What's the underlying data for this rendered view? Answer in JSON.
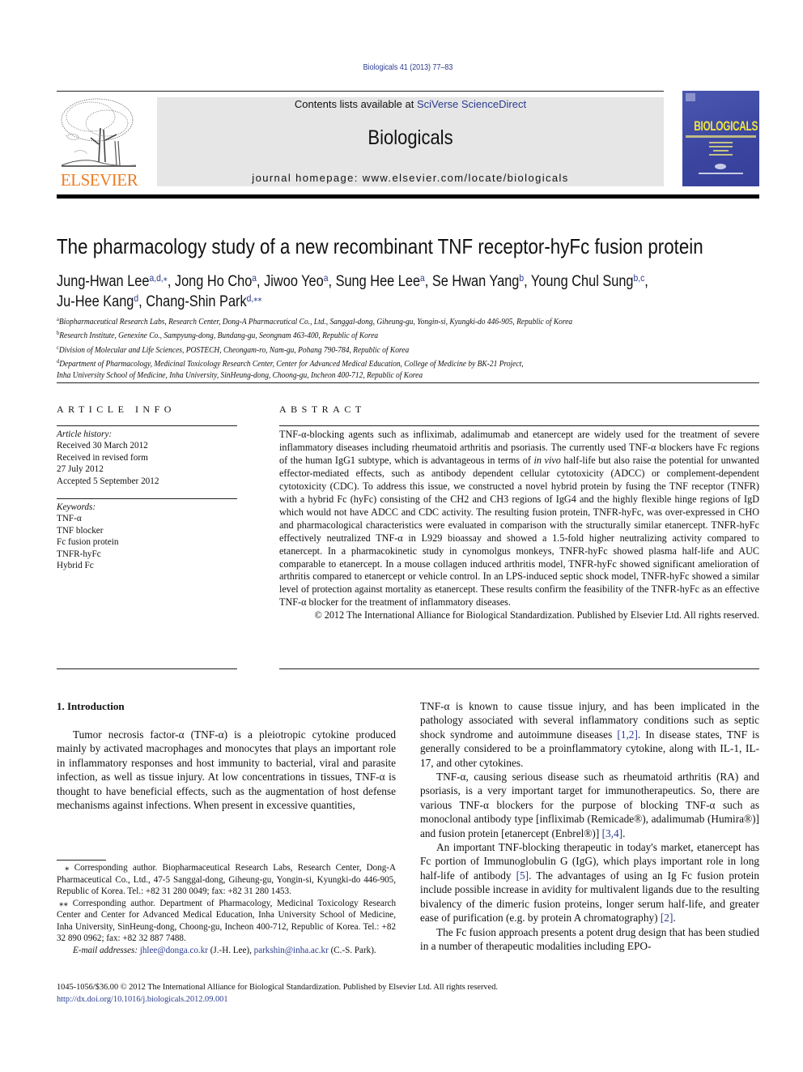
{
  "header": {
    "journal_ref": "Biologicals 41 (2013) 77–83",
    "contents_prefix": "Contents lists available at ",
    "contents_link": "SciVerse ScienceDirect",
    "journal_name": "Biologicals",
    "homepage": "journal homepage: www.elsevier.com/locate/biologicals",
    "publisher_logo_text": "ELSEVIER",
    "cover_title": "BIOLOGICALS"
  },
  "article": {
    "title": "The pharmacology study of a new recombinant TNF receptor-hyFc fusion protein",
    "authors": [
      {
        "name": "Jung-Hwan Lee",
        "sup": "a,d,⁎",
        "sep": ", "
      },
      {
        "name": "Jong Ho Cho",
        "sup": "a",
        "sep": ", "
      },
      {
        "name": "Jiwoo Yeo",
        "sup": "a",
        "sep": ", "
      },
      {
        "name": "Sung Hee Lee",
        "sup": "a",
        "sep": ", "
      },
      {
        "name": "Se Hwan Yang",
        "sup": "b",
        "sep": ", "
      },
      {
        "name": "Young Chul Sung",
        "sup": "b,c",
        "sep": ","
      },
      {
        "name": "Ju-Hee Kang",
        "sup": "d",
        "sep": ", "
      },
      {
        "name": "Chang-Shin Park",
        "sup": "d,⁎⁎",
        "sep": ""
      }
    ],
    "affiliations": [
      {
        "key": "a",
        "text": "Biopharmaceutical Research Labs, Research Center, Dong-A Pharmaceutical Co., Ltd., Sanggal-dong, Giheung-gu, Yongin-si, Kyungki-do 446-905, Republic of Korea"
      },
      {
        "key": "b",
        "text": "Research Institute, Genexine Co., Sampyung-dong, Bundang-gu, Seongnam 463-400, Republic of Korea"
      },
      {
        "key": "c",
        "text": "Division of Molecular and Life Sciences, POSTECH, Cheongam-ro, Nam-gu, Pohang 790-784, Republic of Korea"
      },
      {
        "key": "d",
        "text": "Department of Pharmacology, Medicinal Toxicology Research Center, Center for Advanced Medical Education, College of Medicine by BK-21 Project,"
      },
      {
        "key": "",
        "text": "Inha University School of Medicine, Inha University, SinHeung-dong, Choong-gu, Incheon 400-712, Republic of Korea"
      }
    ]
  },
  "article_info": {
    "heading": "ARTICLE INFO",
    "history_label": "Article history:",
    "history": [
      "Received 30 March 2012",
      "Received in revised form",
      "27 July 2012",
      "Accepted 5 September 2012"
    ],
    "keywords_label": "Keywords:",
    "keywords": [
      "TNF-α",
      "TNF blocker",
      "Fc fusion protein",
      "TNFR-hyFc",
      "Hybrid Fc"
    ]
  },
  "abstract": {
    "heading": "ABSTRACT",
    "body_1": "TNF-α-blocking agents such as infliximab, adalimumab and etanercept are widely used for the treatment of severe inflammatory diseases including rheumatoid arthritis and psoriasis. The currently used TNF-α blockers have Fc regions of the human IgG1 subtype, which is advantageous in terms of ",
    "body_italic": "in vivo",
    "body_2": " half-life but also raise the potential for unwanted effector-mediated effects, such as antibody dependent cellular cytotoxicity (ADCC) or complement-dependent cytotoxicity (CDC). To address this issue, we constructed a novel hybrid protein by fusing the TNF receptor (TNFR) with a hybrid Fc (hyFc) consisting of the CH2 and CH3 regions of IgG4 and the highly flexible hinge regions of IgD which would not have ADCC and CDC activity. The resulting fusion protein, TNFR-hyFc, was over-expressed in CHO and pharmacological characteristics were evaluated in comparison with the structurally similar etanercept. TNFR-hyFc effectively neutralized TNF-α in L929 bioassay and showed a 1.5-fold higher neutralizing activity compared to etanercept. In a pharmacokinetic study in cynomolgus monkeys, TNFR-hyFc showed plasma half-life and AUC comparable to etanercept. In a mouse collagen induced arthritis model, TNFR-hyFc showed significant amelioration of arthritis compared to etanercept or vehicle control. In an LPS-induced septic shock model, TNFR-hyFc showed a similar level of protection against mortality as eta­nercept. These results confirm the feasibility of the TNFR-hyFc as an effective TNF-α blocker for the treatment of inflammatory diseases.",
    "copyright": "© 2012 The International Alliance for Biological Standardization. Published by Elsevier Ltd. All rights reserved."
  },
  "introduction": {
    "heading": "1.  Introduction",
    "left_para": "Tumor necrosis factor-α (TNF-α) is a pleiotropic cytokine produced mainly by activated macrophages and monocytes that plays an important role in inflammatory responses and host immunity to bacterial, viral and parasite infection, as well as tissue injury. At low concentrations in tissues, TNF-α is thought to have beneficial effects, such as the augmentation of host defense mech­anisms against infections. When present in excessive quantities,",
    "right_p1_a": "TNF-α is known to cause tissue injury, and has been implicated in the pathology associated with several inflammatory conditions such as septic shock syndrome and autoimmune diseases ",
    "right_p1_ref": "[1,2]",
    "right_p1_b": ". In disease states, TNF is generally considered to be a proinflammatory cytokine, along with IL-1, IL-17, and other cytokines.",
    "right_p2_a": "TNF-α, causing serious disease such as rheumatoid arthritis (RA) and psoriasis, is a very important target for immunotherapeutics. So, there are various TNF-α blockers for the purpose of blocking TNF-α such as monoclonal antibody type [infliximab (Remicade®), ada­limumab (Humira®)] and fusion protein [etanercept (Enbrel®)] ",
    "right_p2_ref": "[3,4]",
    "right_p2_b": ".",
    "right_p3_a": "An important TNF-blocking therapeutic in today's market, etanercept has Fc portion of Immunoglobulin G (IgG), which plays important role in long half-life of antibody ",
    "right_p3_ref1": "[5]",
    "right_p3_b": ". The advantages of using an Ig Fc fusion protein include possible increase in avidity for multivalent ligands due to the resulting bivalency of the dimeric fusion proteins, longer serum half-life, and greater ease of purifi­cation (e.g. by protein A chromatography) ",
    "right_p3_ref2": "[2]",
    "right_p3_c": ".",
    "right_p4": "The Fc fusion approach presents a potent drug design that has been studied in a number of therapeutic modalities including EPO-"
  },
  "footnotes": {
    "fn1": "⁎ Corresponding author. Biopharmaceutical Research Labs, Research Center, Dong-A Pharmaceutical Co., Ltd., 47-5 Sanggal-dong, Giheung-gu, Yongin-si, Kyungki-do 446-905, Republic of Korea. Tel.: +82 31 280 0049; fax: +82 31 280 1453.",
    "fn2": "⁎⁎ Corresponding author. Department of Pharmacology, Medicinal Toxicology Research Center and Center for Advanced Medical Education, Inha University School of Medicine, Inha University, SinHeung-dong, Choong-gu, Incheon 400-712, Republic of Korea. Tel.: +82 32 890 0962; fax: +82 32 887 7488.",
    "emails_label": "E-mail addresses:",
    "email1": "jhlee@donga.co.kr",
    "email1_who": " (J.-H. Lee), ",
    "email2": "parkshin@inha.ac.kr",
    "email2_who": " (C.-S. Park)."
  },
  "bottom": {
    "issn_line": "1045-1056/$36.00 © 2012 The International Alliance for Biological Standardization. Published by Elsevier Ltd. All rights reserved.",
    "doi": "http://dx.doi.org/10.1016/j.biologicals.2012.09.001"
  },
  "colors": {
    "link": "#2a3b8f",
    "elsevier_orange": "#ee7d22",
    "masthead_gray": "#e6e6e6",
    "cover_blue": "#3b45a0",
    "cover_yellow": "#f2e63a"
  }
}
